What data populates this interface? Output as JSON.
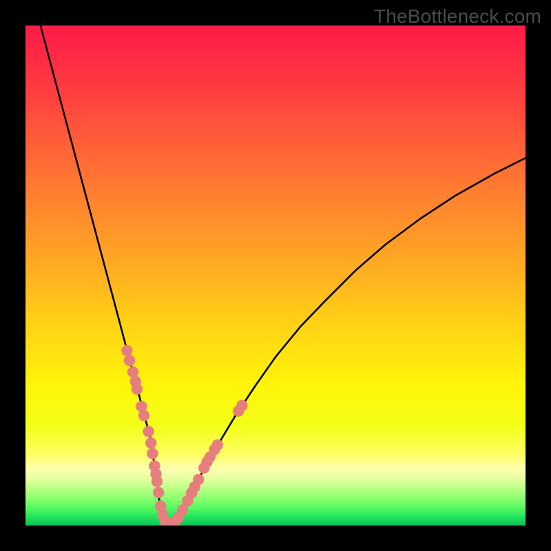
{
  "watermark": "TheBottleneck.com",
  "colors": {
    "frame": "#000000",
    "curve": "#000000",
    "marker_fill": "#e77e7e",
    "marker_stroke": "#da6b6b",
    "gradient_stops": [
      {
        "offset": 0.0,
        "color": "#ff1b47"
      },
      {
        "offset": 0.1,
        "color": "#ff3442"
      },
      {
        "offset": 0.22,
        "color": "#ff5a3a"
      },
      {
        "offset": 0.35,
        "color": "#ff832f"
      },
      {
        "offset": 0.48,
        "color": "#ffab22"
      },
      {
        "offset": 0.6,
        "color": "#ffd315"
      },
      {
        "offset": 0.72,
        "color": "#fff50a"
      },
      {
        "offset": 0.8,
        "color": "#f2ff17"
      },
      {
        "offset": 0.86,
        "color": "#ffff66"
      },
      {
        "offset": 0.885,
        "color": "#ffffb0"
      },
      {
        "offset": 0.905,
        "color": "#e7ff9f"
      },
      {
        "offset": 0.925,
        "color": "#beff88"
      },
      {
        "offset": 0.945,
        "color": "#8dff70"
      },
      {
        "offset": 0.965,
        "color": "#55f95f"
      },
      {
        "offset": 0.985,
        "color": "#1ee05c"
      },
      {
        "offset": 1.0,
        "color": "#0cc358"
      }
    ]
  },
  "chart_data": {
    "type": "line",
    "title": "",
    "xlabel": "",
    "ylabel": "",
    "xlim": [
      0,
      100
    ],
    "ylim": [
      0,
      100
    ],
    "x": [
      3,
      5,
      7,
      9,
      11,
      13,
      15,
      17,
      19,
      20,
      21,
      22,
      23,
      24,
      25,
      25.5,
      26,
      26.5,
      27,
      27.6,
      28.3,
      29.2,
      30.5,
      32,
      34,
      36,
      39,
      42,
      46,
      50,
      55,
      60,
      66,
      72,
      79,
      86,
      94,
      100
    ],
    "values": [
      100,
      92.5,
      85,
      77.5,
      70,
      62.5,
      55,
      47.5,
      40,
      36.2,
      32.5,
      28.7,
      25,
      21.2,
      17.5,
      14,
      10.5,
      7,
      3.5,
      1.2,
      0.5,
      0.5,
      1.5,
      4,
      8,
      12,
      17,
      22,
      28,
      33.7,
      39.8,
      45,
      51,
      56.2,
      61.4,
      66,
      70.5,
      73.5
    ],
    "series": [
      {
        "name": "bottleneck-curve",
        "x_key": "x",
        "y_key": "values"
      }
    ],
    "markers": {
      "name": "config-points",
      "points": [
        {
          "x": 20.3,
          "y": 35.0
        },
        {
          "x": 20.8,
          "y": 33.0
        },
        {
          "x": 21.5,
          "y": 30.7
        },
        {
          "x": 22.0,
          "y": 28.8
        },
        {
          "x": 22.3,
          "y": 27.3
        },
        {
          "x": 23.2,
          "y": 23.8
        },
        {
          "x": 23.7,
          "y": 22.0
        },
        {
          "x": 24.6,
          "y": 18.8
        },
        {
          "x": 25.1,
          "y": 16.5
        },
        {
          "x": 25.4,
          "y": 14.4
        },
        {
          "x": 25.8,
          "y": 11.9
        },
        {
          "x": 26.1,
          "y": 10.3
        },
        {
          "x": 26.3,
          "y": 8.8
        },
        {
          "x": 26.6,
          "y": 6.6
        },
        {
          "x": 27.0,
          "y": 3.9
        },
        {
          "x": 27.4,
          "y": 2.2
        },
        {
          "x": 27.9,
          "y": 0.9
        },
        {
          "x": 28.6,
          "y": 0.5
        },
        {
          "x": 29.3,
          "y": 0.55
        },
        {
          "x": 29.9,
          "y": 0.75
        },
        {
          "x": 30.6,
          "y": 1.6
        },
        {
          "x": 31.4,
          "y": 3.1
        },
        {
          "x": 32.4,
          "y": 4.9
        },
        {
          "x": 33.2,
          "y": 6.5
        },
        {
          "x": 33.8,
          "y": 7.7
        },
        {
          "x": 34.6,
          "y": 9.2
        },
        {
          "x": 35.7,
          "y": 11.5
        },
        {
          "x": 36.3,
          "y": 12.7
        },
        {
          "x": 36.9,
          "y": 13.7
        },
        {
          "x": 37.8,
          "y": 15.2
        },
        {
          "x": 38.4,
          "y": 16.1
        },
        {
          "x": 42.6,
          "y": 22.9
        },
        {
          "x": 43.3,
          "y": 24.0
        }
      ]
    }
  }
}
